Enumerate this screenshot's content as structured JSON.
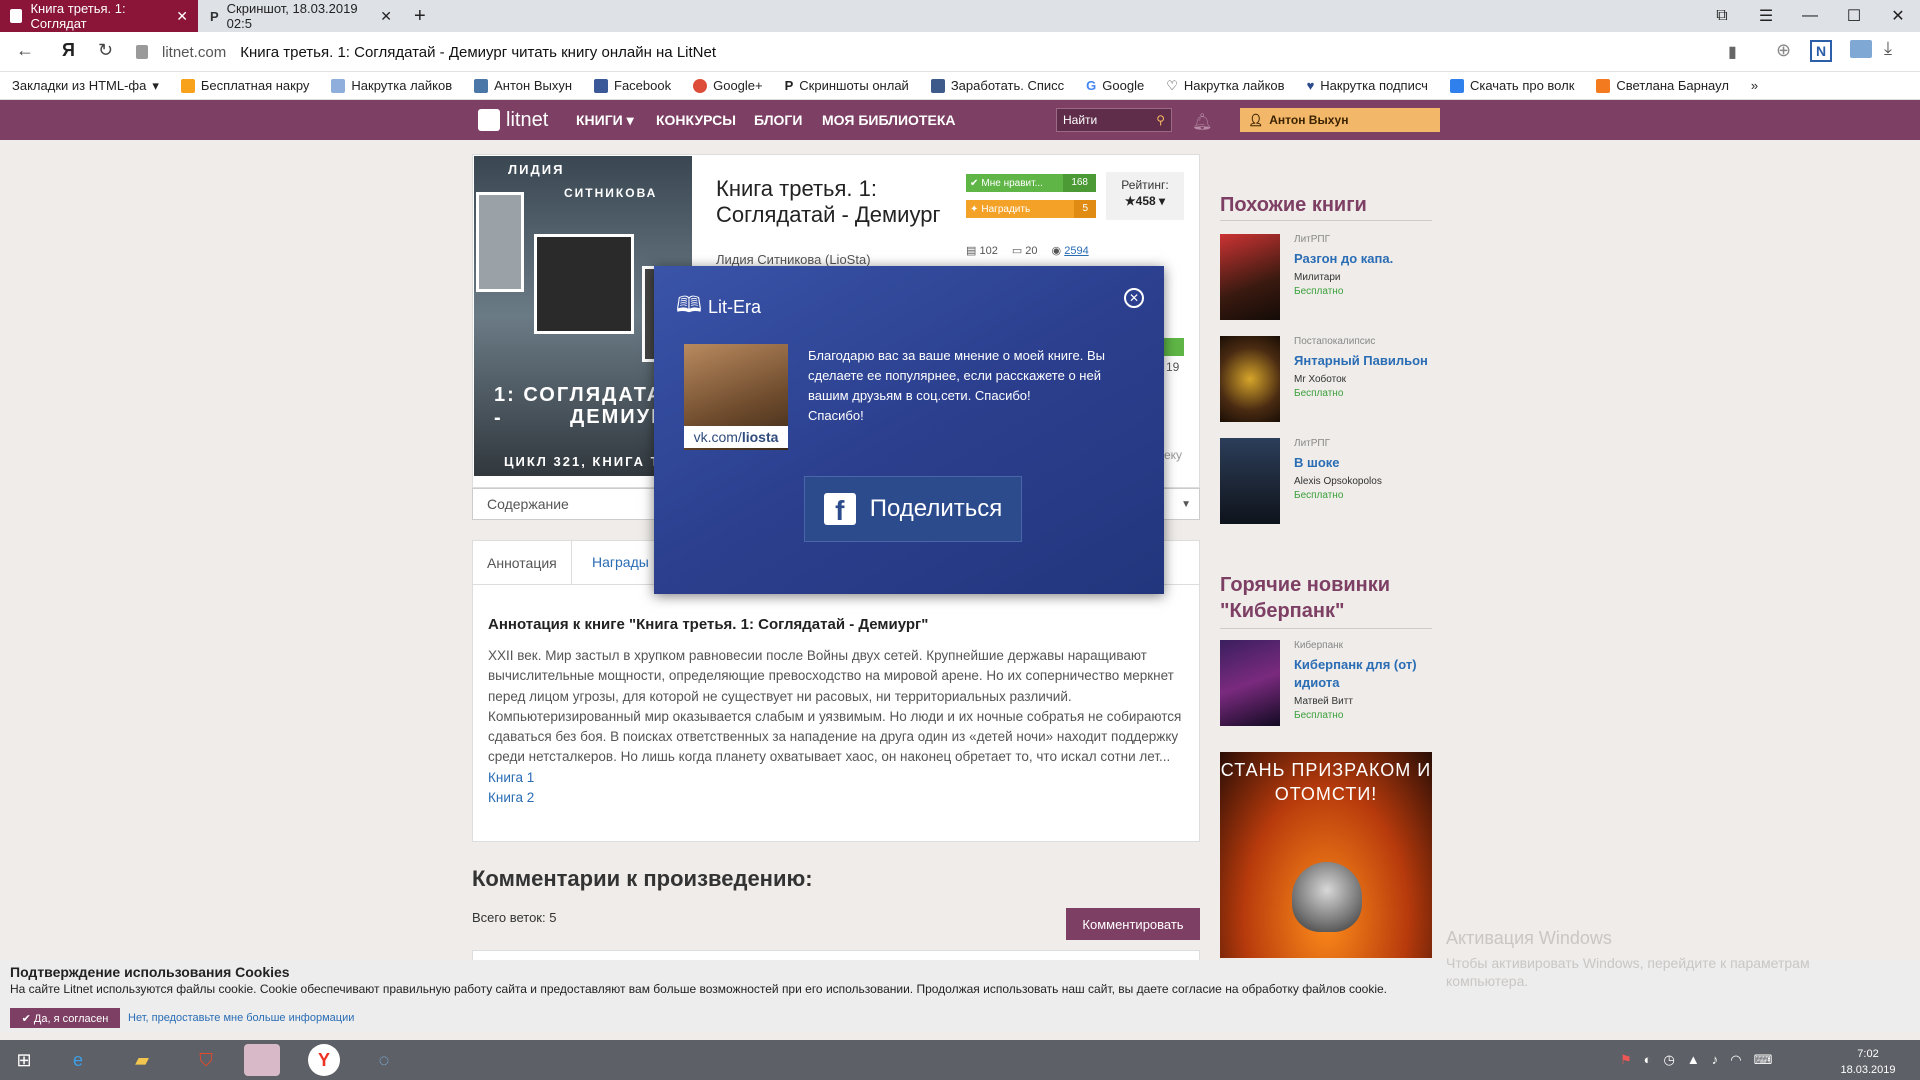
{
  "browser": {
    "tabs": [
      {
        "label": "Книга третья. 1: Соглядат",
        "close": "✕"
      },
      {
        "label": "Скриншот, 18.03.2019 02:5",
        "close": "✕"
      }
    ],
    "new_tab": "+",
    "url_host": "litnet.com",
    "page_title": "Книга третья. 1: Соглядатай - Демиург читать книгу онлайн на LitNet",
    "bookmarks": [
      "Закладки из HTML-фа",
      "Бесплатная накру",
      "Накрутка лайков",
      "Антон Выхун",
      "Facebook",
      "Google+",
      "Скриншоты онлай",
      "Заработать. Списс",
      "Google",
      "Накрутка лайков",
      "Накрутка подписч",
      "Скачать про волк",
      "Светлана Барнаул"
    ],
    "more_bookmarks": "»"
  },
  "site": {
    "logo": "litnet",
    "menu": [
      "КНИГИ ▾",
      "КОНКУРСЫ",
      "БЛОГИ",
      "МОЯ БИБЛИОТЕКА"
    ],
    "search_placeholder": "Найти",
    "user": "Антон Выхун"
  },
  "book": {
    "cover_author_1": "ЛИДИЯ",
    "cover_author_2": "СИТНИКОВА",
    "cover_title_1": "1: СОГЛЯДАТАЙ -",
    "cover_title_2": "ДЕМИУРГ",
    "cover_series": "ЦИКЛ 321, КНИГА ТРЕТ",
    "title": "Книга третья. 1: Соглядатай - Демиург",
    "author": "Лидия Ситникова (LioSta)",
    "like_label": "Мне нравит...",
    "like_count": "168",
    "award_label": "Наградить",
    "award_count": "5",
    "rating_label": "Рейтинг:",
    "rating_value": "★458 ▾",
    "stat_pages": "102",
    "stat_comments": "20",
    "stat_views": "2594",
    "hidden_partial": "19",
    "hidden_partial2": "еку",
    "contents_select": "Содержание",
    "contents_arrow": "▼",
    "tab_annotation": "Аннотация",
    "tab_awards": "Награды",
    "annotation_heading": "Аннотация к книге \"Книга третья. 1: Соглядатай - Демиург\"",
    "annotation_text": "XXII век. Мир застыл в хрупком равновесии после Войны двух сетей. Крупнейшие державы наращивают вычислительные мощности, определяющие превосходство на мировой арене. Но их соперничество меркнет перед лицом угрозы, для которой не существует ни расовых, ни территориальных различий. Компьютеризированный мир оказывается слабым и уязвимым. Но люди и их ночные собратья не собираются сдаваться без боя. В поисках ответственных за нападение на друга один из «детей ночи» находит поддержку среди нетсталкеров. Но лишь когда планету охватывает хаос, он наконец обретает то, что искал сотни лет...",
    "link_book1": "Книга 1",
    "link_book2": "Книга 2",
    "comments_heading": "Комментарии к произведению:",
    "threads": "Всего веток: 5",
    "comment_button": "Комментировать"
  },
  "sidebar": {
    "similar_heading": "Похожие книги",
    "similar": [
      {
        "genre": "ЛитРПГ",
        "title": "Разгон до капа.",
        "author": "Милитари",
        "price": "Бесплатно"
      },
      {
        "genre": "Постапокалипсис",
        "title": "Янтарный Павильон",
        "author": "Mr Хоботок",
        "price": "Бесплатно"
      },
      {
        "genre": "ЛитРПГ",
        "title": "В шоке",
        "author": "Alexis Opsokopolos",
        "price": "Бесплатно"
      }
    ],
    "hot_heading": "Горячие новинки \"Киберпанк\"",
    "hot": [
      {
        "genre": "Киберпанк",
        "title": "Киберпанк для (от) идиота",
        "author": "Матвей Витт",
        "price": "Бесплатно"
      }
    ],
    "ad_text": "СТАНЬ ПРИЗРАКОМ И ОТОМСТИ!"
  },
  "modal": {
    "brand": "Lit-Era",
    "close": "✕",
    "vk_handle_prefix": "vk.com/",
    "vk_handle": "liosta",
    "message": "Благодарю вас за ваше мнение о моей книге. Вы сделаете ее популярнее, если расскажете о ней вашим друзьям в соц.сети. Спасибо!",
    "message2": "Спасибо!",
    "share_button": "Поделиться"
  },
  "cookies": {
    "heading": "Подтверждение использования Cookies",
    "text": "На сайте Litnet используются файлы cookie. Cookie обеспечивают правильную работу сайта и предоставляют вам больше возможностей при его использовании. Продолжая использовать наш сайт, вы даете согласие на обработку файлов cookie.",
    "accept": "✔ Да, я согласен",
    "more": "Нет, предоставьте мне больше информации"
  },
  "windows": {
    "activation_title": "Активация Windows",
    "activation_text": "Чтобы активировать Windows, перейдите к параметрам компьютера.",
    "time": "7:02",
    "date": "18.03.2019"
  },
  "colors": {
    "brand": "#7d3f63",
    "like": "#5fb646",
    "award": "#f4a227",
    "modal": "#2b3f8e"
  }
}
